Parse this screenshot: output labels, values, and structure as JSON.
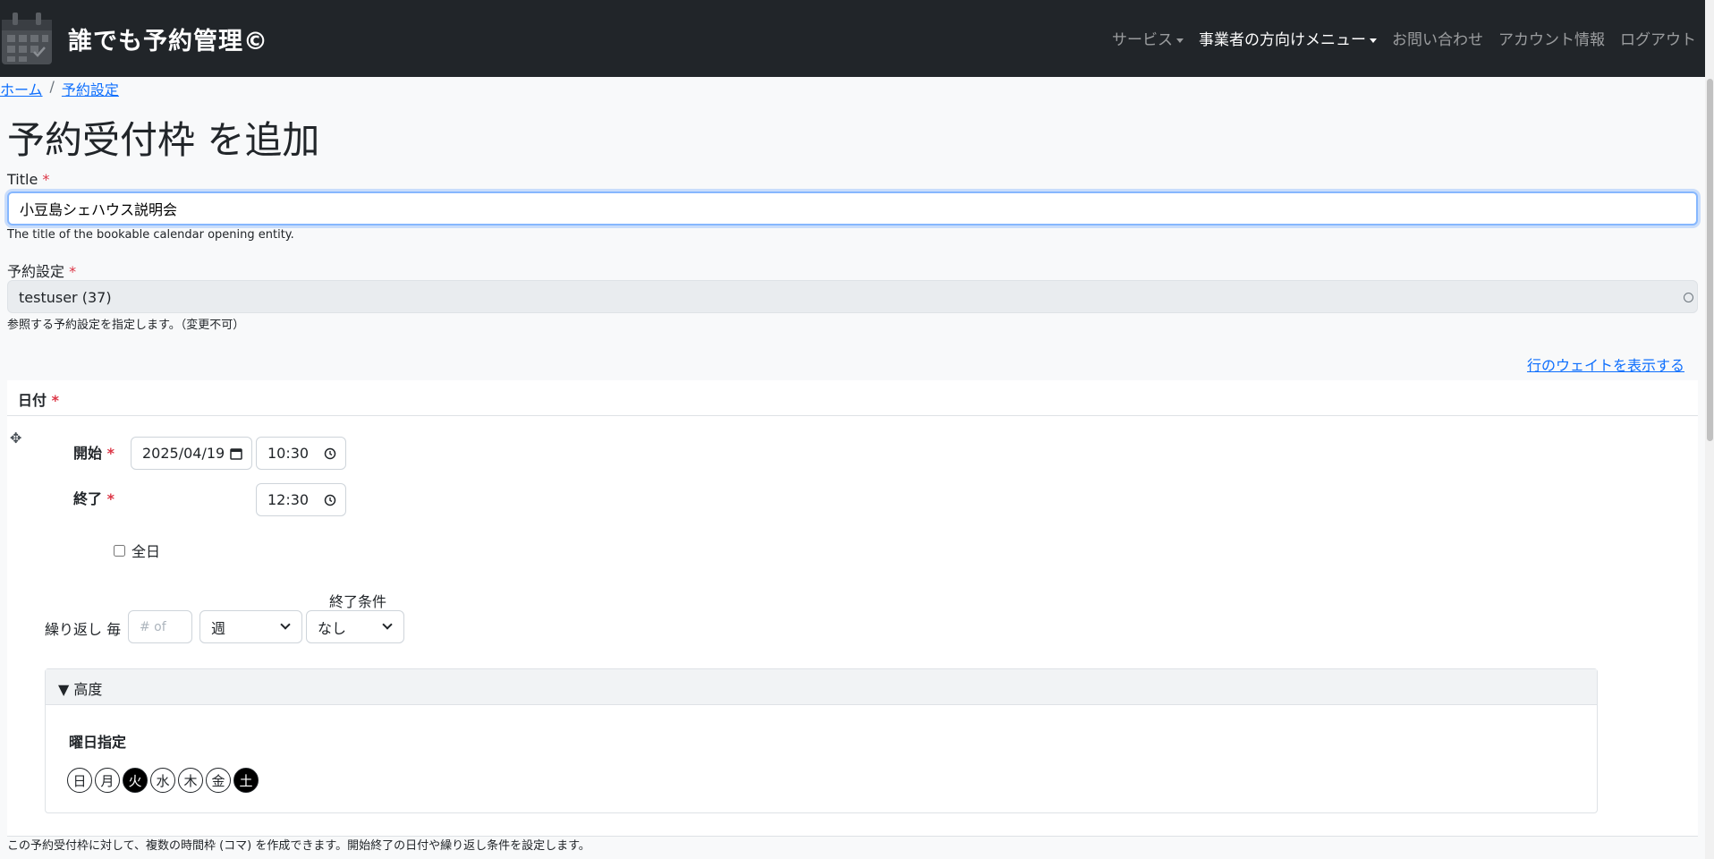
{
  "navbar": {
    "brand": "誰でも予約管理©",
    "items": [
      {
        "label": "サービス"
      },
      {
        "label": "事業者の方向けメニュー"
      },
      {
        "label": "お問い合わせ"
      },
      {
        "label": "アカウント情報"
      },
      {
        "label": "ログアウト"
      }
    ]
  },
  "breadcrumb": {
    "home": "ホーム",
    "sep": "/",
    "current": "予約設定"
  },
  "page_title": "予約受付枠 を追加",
  "required_mark": "*",
  "title_field": {
    "label": "Title",
    "value": "小豆島シェハウス説明会",
    "help": "The title of the bookable calendar opening entity."
  },
  "reservation_field": {
    "label": "予約設定",
    "value": "testuser (37)",
    "help": "参照する予約設定を指定します。（変更不可）"
  },
  "weight_link": "行のウェイトを表示する",
  "date_section": {
    "label": "日付",
    "start_label": "開始",
    "start_date": "2025/04/19",
    "start_time": "10:30",
    "end_label": "終了",
    "end_time": "12:30",
    "allday_label": "全日",
    "end_condition_label": "終了条件",
    "repeat_label": "繰り返し 毎",
    "repeat_placeholder": "# of",
    "repeat_unit": "週",
    "end_condition": "なし",
    "advanced_label": "▼ 高度",
    "dow_label": "曜日指定",
    "days": [
      "日",
      "月",
      "火",
      "水",
      "木",
      "金",
      "土"
    ],
    "days_selected": [
      "火",
      "土"
    ]
  },
  "footer_help": "この予約受付枠に対して、複数の時間枠 (コマ) を作成できます。開始終了の日付や繰り返し条件を設定します。"
}
